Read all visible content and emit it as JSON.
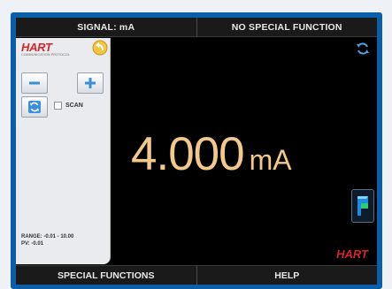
{
  "top_bar": {
    "left_label": "SIGNAL: mA",
    "right_label": "NO SPECIAL FUNCTION"
  },
  "panel": {
    "logo_text": "HART",
    "logo_subtext": "COMMUNICATION PROTOCOL",
    "scan_label": "SCAN",
    "scan_checked": false,
    "range_text": "RANGE: -0.01 - 10.00",
    "pv_text": "PV: -0.01"
  },
  "reading": {
    "value": "4.000",
    "unit": "mA"
  },
  "brand": {
    "text": "HART"
  },
  "bottom_bar": {
    "left_label": "SPECIAL FUNCTIONS",
    "right_label": "HELP"
  },
  "icons": {
    "refresh": "refresh-icon",
    "back": "back-arrow-icon",
    "minus": "minus-icon",
    "plus": "plus-icon",
    "app": "app-launcher-icon"
  },
  "colors": {
    "reading": "#f2c98a",
    "hart_red": "#d4262b",
    "bezel": "#0b5fa8",
    "button_icon_blue": "#3a8fd6"
  }
}
